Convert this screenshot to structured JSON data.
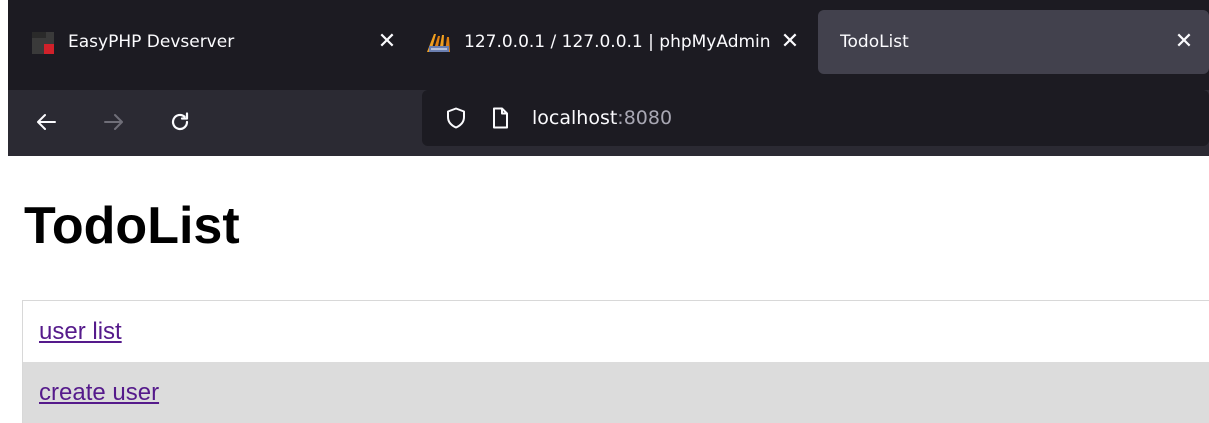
{
  "browser": {
    "tabs": [
      {
        "title": "EasyPHP Devserver",
        "icon": "easyphp-icon",
        "active": false
      },
      {
        "title": "127.0.0.1 / 127.0.0.1 | phpMyAdmin",
        "icon": "phpmyadmin-icon",
        "active": false
      },
      {
        "title": "TodoList",
        "icon": "",
        "active": true
      }
    ],
    "close_glyph": "✕",
    "nav": {
      "back_icon": "arrow-left-icon",
      "forward_icon": "arrow-right-icon",
      "reload_icon": "reload-icon"
    },
    "url": {
      "host": "localhost",
      "port": ":8080",
      "shield_icon": "shield-icon",
      "page_icon": "page-icon"
    },
    "colors": {
      "tabstrip": "#1c1b22",
      "active_tab": "#42414d",
      "navbar": "#2b2a33",
      "urlbar": "#1c1b22"
    }
  },
  "page": {
    "title": "TodoList",
    "menu": [
      {
        "label": "user list"
      },
      {
        "label": "create user"
      }
    ],
    "colors": {
      "link": "#551a8b",
      "alt_row": "#dcdcdc"
    }
  }
}
